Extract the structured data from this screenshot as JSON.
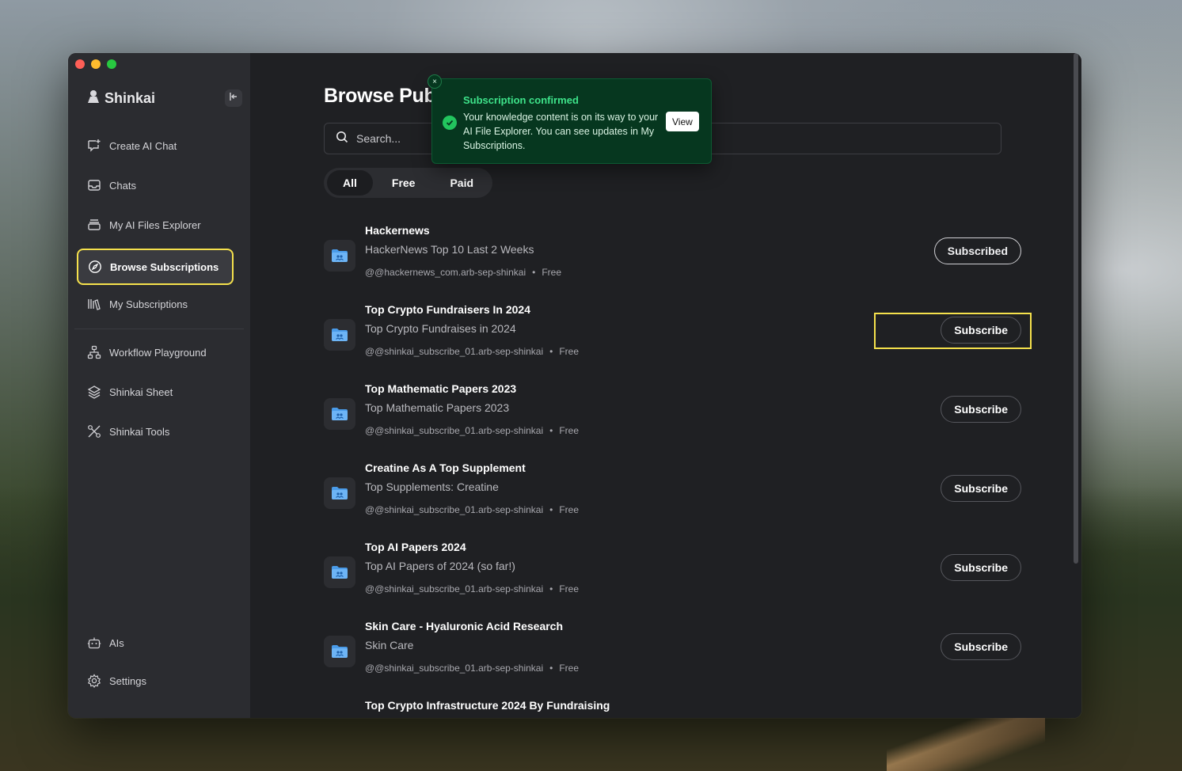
{
  "app": {
    "name": "Shinkai"
  },
  "sidebar": {
    "items": [
      {
        "label": "Create AI Chat",
        "icon": "chat-plus-icon"
      },
      {
        "label": "Chats",
        "icon": "inbox-icon"
      },
      {
        "label": "My AI Files Explorer",
        "icon": "archive-icon"
      },
      {
        "label": "Browse Subscriptions",
        "icon": "compass-icon"
      },
      {
        "label": "My Subscriptions",
        "icon": "library-icon"
      },
      {
        "label": "Workflow Playground",
        "icon": "workflow-icon"
      },
      {
        "label": "Shinkai Sheet",
        "icon": "layers-icon"
      },
      {
        "label": "Shinkai Tools",
        "icon": "tools-icon"
      }
    ],
    "bottom": [
      {
        "label": "AIs",
        "icon": "bot-icon"
      },
      {
        "label": "Settings",
        "icon": "gear-icon"
      }
    ]
  },
  "main": {
    "title": "Browse Publ",
    "search": {
      "placeholder": "Search..."
    },
    "filters": [
      "All",
      "Free",
      "Paid"
    ],
    "items": [
      {
        "title": "Hackernews",
        "desc": "HackerNews Top 10 Last 2 Weeks",
        "owner": "@@hackernews_com.arb-sep-shinkai",
        "price": "Free",
        "button": "Subscribed"
      },
      {
        "title": "Top Crypto Fundraisers In 2024",
        "desc": "Top Crypto Fundraises in 2024",
        "owner": "@@shinkai_subscribe_01.arb-sep-shinkai",
        "price": "Free",
        "button": "Subscribe"
      },
      {
        "title": "Top Mathematic Papers 2023",
        "desc": "Top Mathematic Papers 2023",
        "owner": "@@shinkai_subscribe_01.arb-sep-shinkai",
        "price": "Free",
        "button": "Subscribe"
      },
      {
        "title": "Creatine As A Top Supplement",
        "desc": "Top Supplements: Creatine",
        "owner": "@@shinkai_subscribe_01.arb-sep-shinkai",
        "price": "Free",
        "button": "Subscribe"
      },
      {
        "title": "Top AI Papers 2024",
        "desc": "Top AI Papers of 2024 (so far!)",
        "owner": "@@shinkai_subscribe_01.arb-sep-shinkai",
        "price": "Free",
        "button": "Subscribe"
      },
      {
        "title": "Skin Care - Hyaluronic Acid Research",
        "desc": "Skin Care",
        "owner": "@@shinkai_subscribe_01.arb-sep-shinkai",
        "price": "Free",
        "button": "Subscribe"
      },
      {
        "title": "Top Crypto Infrastructure 2024 By Fundraising",
        "desc": "",
        "owner": "",
        "price": "",
        "button": ""
      }
    ],
    "dot": "•"
  },
  "toast": {
    "title": "Subscription confirmed",
    "body": "Your knowledge content is on its way to your AI File Explorer. You can see updates in My Subscriptions.",
    "action": "View",
    "close": "×"
  },
  "colors": {
    "accent_highlight": "#f5e14c",
    "toast_bg": "#06371f",
    "toast_title": "#3ee38a",
    "success": "#22c55e"
  }
}
